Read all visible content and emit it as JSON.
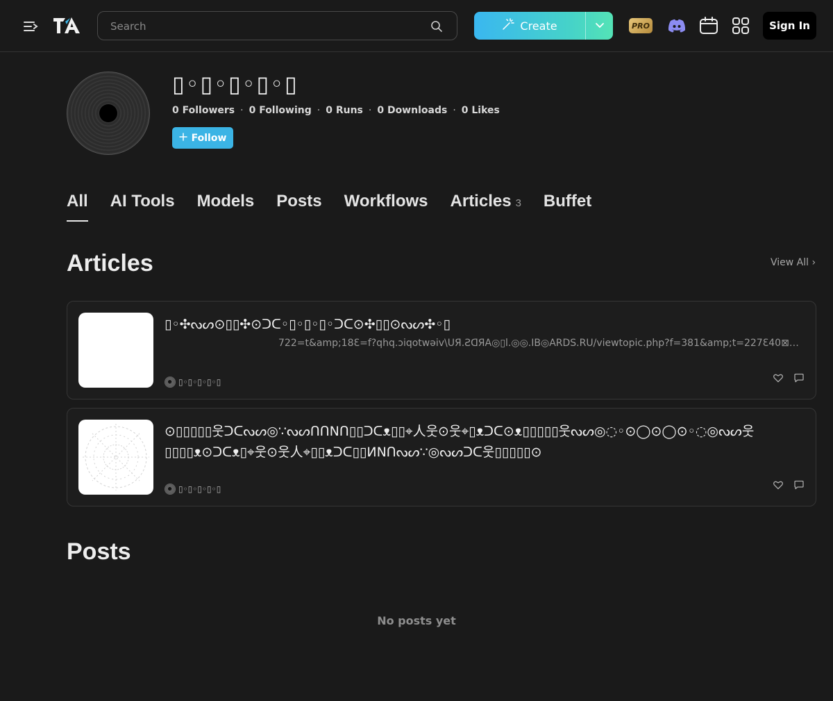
{
  "header": {
    "search_placeholder": "Search",
    "create_label": "Create",
    "pro_label": "PRO",
    "signin_label": "Sign In"
  },
  "profile": {
    "name": "▯◦▯◦▯◦▯◦▯",
    "stats": {
      "followers": "0 Followers",
      "following": "0 Following",
      "runs": "0 Runs",
      "downloads": "0 Downloads",
      "likes": "0 Likes"
    },
    "follow_label": "Follow"
  },
  "tabs": [
    {
      "label": "All",
      "count": ""
    },
    {
      "label": "AI Tools",
      "count": ""
    },
    {
      "label": "Models",
      "count": ""
    },
    {
      "label": "Posts",
      "count": ""
    },
    {
      "label": "Workflows",
      "count": ""
    },
    {
      "label": "Articles",
      "count": "3"
    },
    {
      "label": "Buffet",
      "count": ""
    }
  ],
  "articles_section": {
    "title": "Articles",
    "view_all": "View All ›"
  },
  "articles": [
    {
      "title": "▯◦✣ᔓᔕ⊙▯▯✣⊙ᑐᑕ◦▯◦▯◦▯◦ᑐᑕ⊙✣▯▯⊙ᔓᔕ✣◦▯",
      "url": "722=t&amp;18Ɛ=f?qhq.ɔiqotwəiv\\UЯ.ƧᗡЯA◎▯l.◎◎.IB◎ARDS.RU/viewtopic.php?f=381&amp;t=227Ɛ40⊠⊠7⊠22...",
      "author": "▯◦▯◦▯◦▯◦▯"
    },
    {
      "title": "⊙▯▯▯▯▯웃ᑐᑕᔓᔕ◎∵ᔓᔕᑎᑎNᑎ▯▯ᑐᑕᴥ▯▯⌖人웃⊙웃⌖▯ᴥᑐᑕ⊙ᴥ▯▯▯▯▯웃ᔓᔕ◎◌◦⊙◯⊙◯⊙◦◌◎ᔓᔕ웃▯▯▯▯ᴥ⊙ᑐᑕᴥ▯⌖웃⊙웃人⌖▯▯ᴥᑐᑕ▯▯ИNᑎᔓᔕ∵◎ᔓᔕᑐᑕ웃▯▯▯▯▯⊙",
      "url": "",
      "author": "▯◦▯◦▯◦▯◦▯"
    }
  ],
  "posts_section": {
    "title": "Posts",
    "empty": "No posts yet"
  },
  "colors": {
    "background": "#1a1a1a",
    "accent": "#3bb4e5",
    "create_gradient_start": "#3ab7f0",
    "create_gradient_end": "#54e3b6"
  }
}
